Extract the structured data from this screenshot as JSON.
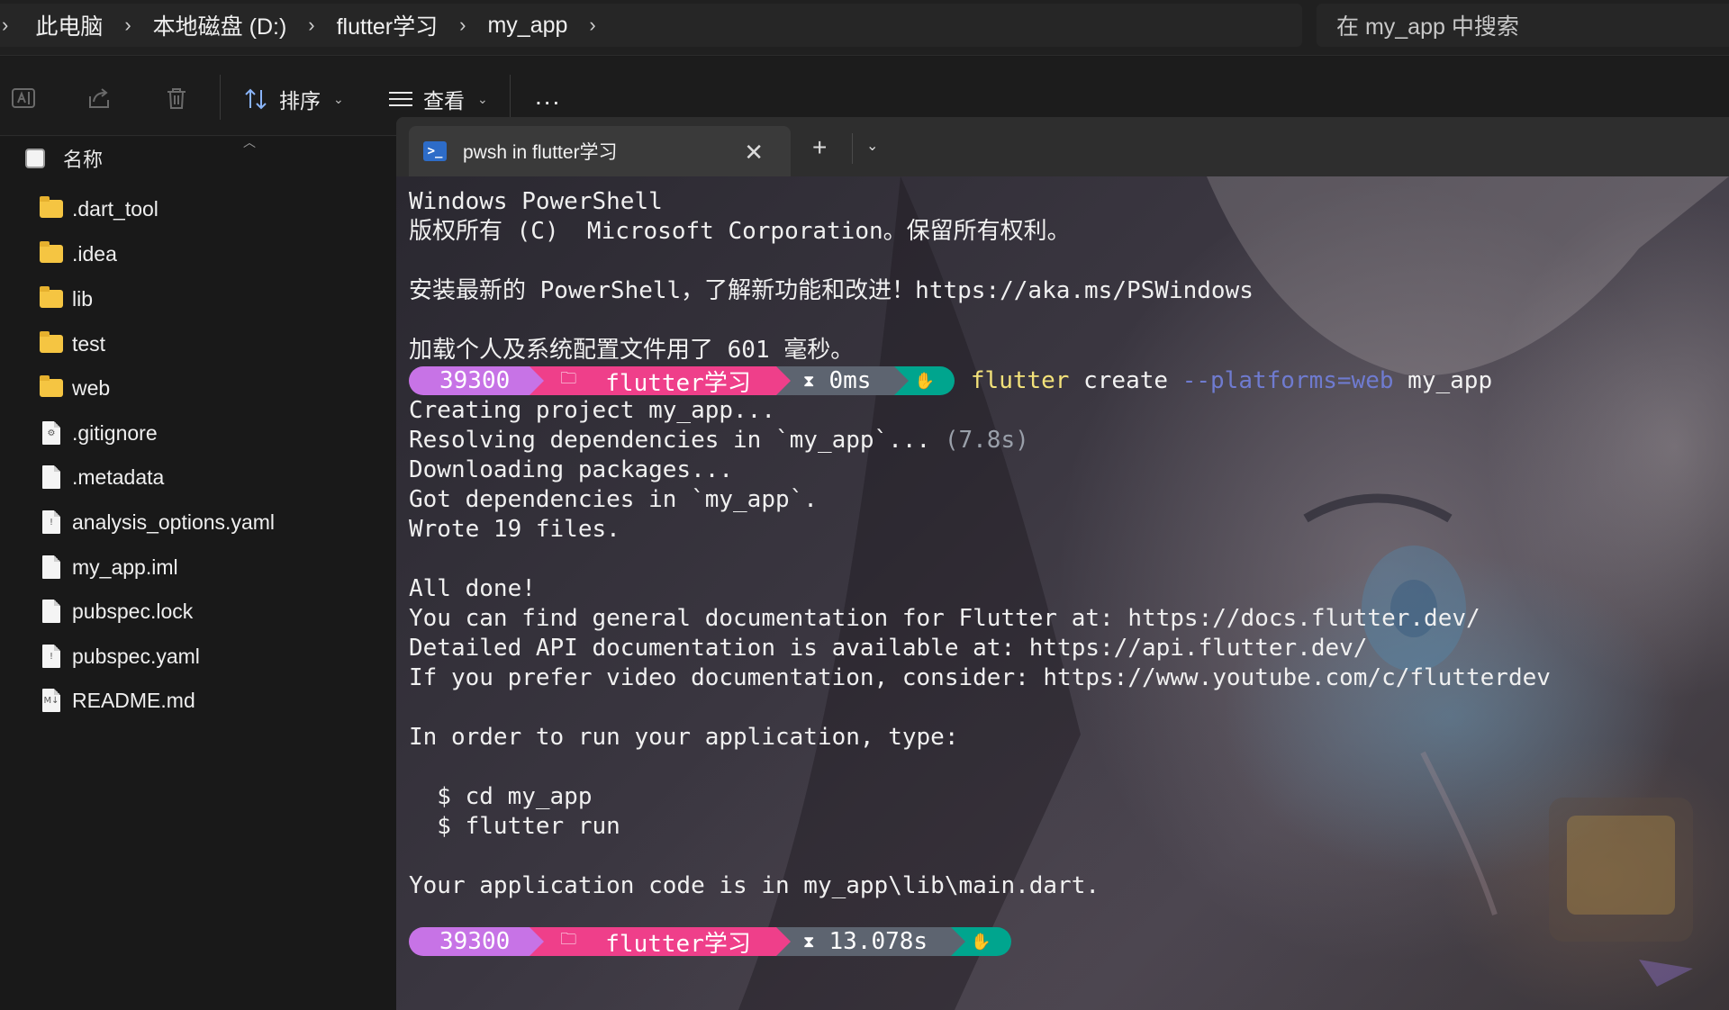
{
  "explorer": {
    "breadcrumb": [
      "此电脑",
      "本地磁盘 (D:)",
      "flutter学习",
      "my_app"
    ],
    "search_placeholder": "在 my_app 中搜索",
    "toolbar": {
      "sort_label": "排序",
      "view_label": "查看",
      "more_label": "..."
    },
    "column_name": "名称",
    "files": [
      {
        "name": ".dart_tool",
        "type": "folder"
      },
      {
        "name": ".idea",
        "type": "folder"
      },
      {
        "name": "lib",
        "type": "folder"
      },
      {
        "name": "test",
        "type": "folder"
      },
      {
        "name": "web",
        "type": "folder"
      },
      {
        "name": ".gitignore",
        "type": "config"
      },
      {
        "name": ".metadata",
        "type": "file"
      },
      {
        "name": "analysis_options.yaml",
        "type": "yaml"
      },
      {
        "name": "my_app.iml",
        "type": "file"
      },
      {
        "name": "pubspec.lock",
        "type": "file"
      },
      {
        "name": "pubspec.yaml",
        "type": "yaml"
      },
      {
        "name": "README.md",
        "type": "markdown"
      }
    ]
  },
  "terminal": {
    "tab_title": "pwsh in flutter学习",
    "lines": [
      "Windows PowerShell",
      "版权所有 (C)  Microsoft Corporation。保留所有权利。",
      "",
      "安装最新的 PowerShell，了解新功能和改进！https://aka.ms/PSWindows",
      "",
      "加载个人及系统配置文件用了 601 毫秒。"
    ],
    "prompt1": {
      "pid": "39300",
      "folder": "flutter学习",
      "time": "0ms",
      "command": "flutter",
      "arg1": "create",
      "arg2": "--platforms=web",
      "arg3": "my_app"
    },
    "output": [
      "Creating project my_app...",
      "Resolving dependencies in `my_app`...",
      "Downloading packages...",
      "Got dependencies in `my_app`.",
      "Wrote 19 files.",
      "",
      "All done!",
      "You can find general documentation for Flutter at: https://docs.flutter.dev/",
      "Detailed API documentation is available at: https://api.flutter.dev/",
      "If you prefer video documentation, consider: https://www.youtube.com/c/flutterdev",
      "",
      "In order to run your application, type:",
      "",
      "  $ cd my_app",
      "  $ flutter run",
      "",
      "Your application code is in my_app\\lib\\main.dart."
    ],
    "resolve_time": "(7.8s)",
    "prompt2": {
      "pid": "39300",
      "folder": "flutter学习",
      "time": "13.078s"
    }
  },
  "colors": {
    "seg_pid": "#c773e6",
    "seg_folder": "#ef3f8a",
    "seg_time": "#5d6470",
    "seg_status": "#00a58e",
    "command": "#f3e27a",
    "flag": "#6f7bd0"
  }
}
